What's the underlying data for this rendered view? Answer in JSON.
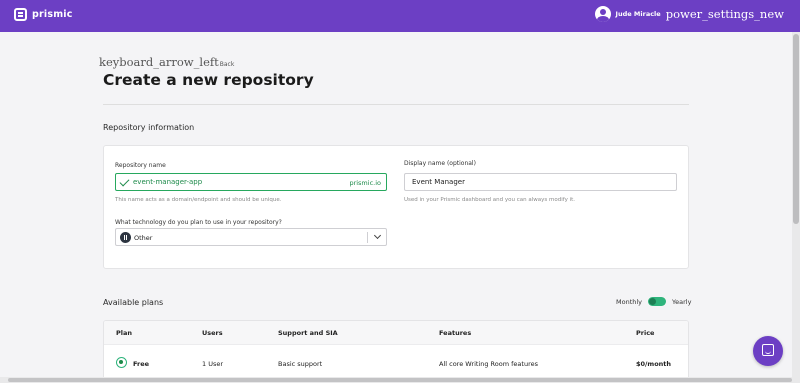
{
  "topbar": {
    "logo_text": "prismic",
    "user_name": "Jude Miracle",
    "power_icon_text": "power_settings_new"
  },
  "page": {
    "back_icon_text": "keyboard_arrow_left",
    "back_label": "Back",
    "title": "Create a new repository"
  },
  "repo_info": {
    "section_title": "Repository information",
    "repo_name": {
      "label": "Repository name",
      "value": "event-manager-app",
      "suffix": "prismic.io",
      "helper": "This name acts as a domain/endpoint and should be unique."
    },
    "display_name": {
      "label": "Display name (optional)",
      "value": "Event Manager",
      "helper": "Used in your Prismic dashboard and you can always modify it."
    },
    "technology": {
      "label": "What technology do you plan to use in your repository?",
      "value": "Other"
    }
  },
  "plans": {
    "section_title": "Available plans",
    "toggle_left": "Monthly",
    "toggle_right": "Yearly",
    "columns": [
      "Plan",
      "Users",
      "Support and SIA",
      "Features",
      "Price"
    ],
    "rows": [
      {
        "plan": "Free",
        "users": "1 User",
        "support": "Basic support",
        "features": "All core Writing Room features",
        "price": "$0/month"
      }
    ]
  },
  "colors": {
    "brand": "#6c3fc4",
    "success": "#1d8a4a",
    "toggle": "#2fb47c"
  }
}
